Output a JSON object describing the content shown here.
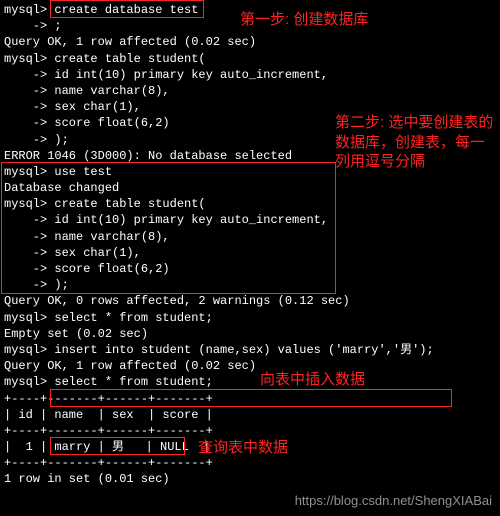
{
  "term": {
    "l01": "mysql> create database test",
    "l02": "    -> ;",
    "l03": "Query OK, 1 row affected (0.02 sec)",
    "l04": "",
    "l05": "mysql> create table student(",
    "l06": "    -> id int(10) primary key auto_increment,",
    "l07": "    -> name varchar(8),",
    "l08": "    -> sex char(1),",
    "l09": "    -> score float(6,2)",
    "l10": "    -> );",
    "l11": "ERROR 1046 (3D000): No database selected",
    "l12": "mysql> use test",
    "l13": "Database changed",
    "l14": "mysql> create table student(",
    "l15": "    -> id int(10) primary key auto_increment,",
    "l16": "    -> name varchar(8),",
    "l17": "    -> sex char(1),",
    "l18": "    -> score float(6,2)",
    "l19": "    -> );",
    "l20": "Query OK, 0 rows affected, 2 warnings (0.12 sec)",
    "l21": "",
    "l22": "mysql> select * from student;",
    "l23": "Empty set (0.02 sec)",
    "l24": "",
    "l25": "mysql> insert into student (name,sex) values ('marry','男');",
    "l26": "Query OK, 1 row affected (0.02 sec)",
    "l27": "",
    "l28": "mysql> select * from student;",
    "l29": "+----+-------+------+-------+",
    "l30": "| id | name  | sex  | score |",
    "l31": "+----+-------+------+-------+",
    "l32": "|  1 | marry | 男   | NULL  |",
    "l33": "+----+-------+------+-------+",
    "l34": "1 row in set (0.01 sec)"
  },
  "annot": {
    "a1": "第一步: 创建数据库",
    "a2": "第二步: 选中要创建表的数据库，创建表，每一列用逗号分隔",
    "a3": "向表中插入数据",
    "a4": "查询表中数据"
  },
  "watermark": "https://blog.csdn.net/ShengXIABai"
}
